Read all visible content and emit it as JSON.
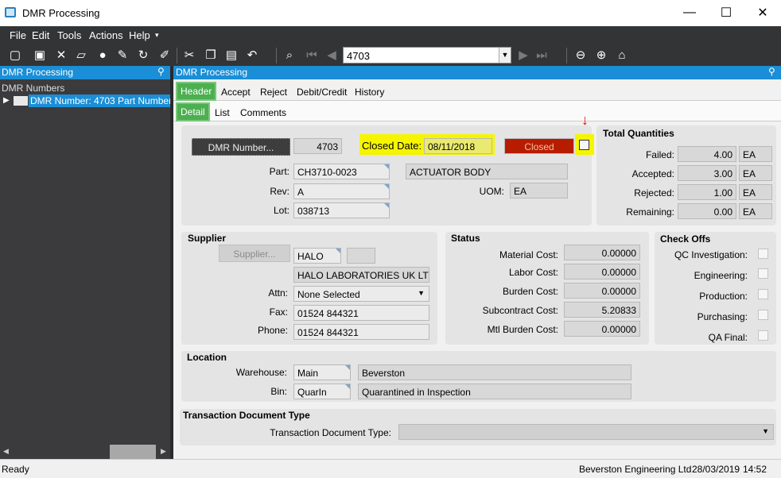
{
  "window": {
    "title": "DMR Processing",
    "min": "—",
    "max": "☐",
    "close": "✕"
  },
  "menu": [
    "File",
    "Edit",
    "Tools",
    "Actions",
    "Help"
  ],
  "toolbar": {
    "combo_value": "4703"
  },
  "left_panel": {
    "header": "DMR Processing",
    "tree_title": "DMR Numbers",
    "tree_item": "DMR Number: 4703 Part Number:"
  },
  "main": {
    "header": "DMR Processing",
    "tabs": [
      "Header",
      "Accept",
      "Reject",
      "Debit/Credit",
      "History"
    ],
    "subtabs": [
      "Detail",
      "List",
      "Comments"
    ]
  },
  "detail": {
    "dmr_button": "DMR Number...",
    "dmr_number": "4703",
    "closed_date_label": "Closed Date:",
    "closed_date": "08/11/2018",
    "closed_status": "Closed",
    "part_label": "Part:",
    "part": "CH3710-0023",
    "part_desc": "ACTUATOR BODY",
    "rev_label": "Rev:",
    "rev": "A",
    "uom_label": "UOM:",
    "uom": "EA",
    "lot_label": "Lot:",
    "lot": "038713"
  },
  "totals": {
    "title": "Total Quantities",
    "rows": [
      {
        "label": "Failed:",
        "value": "4.00",
        "uom": "EA"
      },
      {
        "label": "Accepted:",
        "value": "3.00",
        "uom": "EA"
      },
      {
        "label": "Rejected:",
        "value": "1.00",
        "uom": "EA"
      },
      {
        "label": "Remaining:",
        "value": "0.00",
        "uom": "EA"
      }
    ]
  },
  "supplier": {
    "title": "Supplier",
    "button": "Supplier...",
    "code": "HALO",
    "name": "HALO LABORATORIES UK LT",
    "attn_label": "Attn:",
    "attn": "None Selected",
    "fax_label": "Fax:",
    "fax": "01524 844321",
    "phone_label": "Phone:",
    "phone": "01524 844321"
  },
  "status": {
    "title": "Status",
    "rows": [
      {
        "label": "Material Cost:",
        "value": "0.00000"
      },
      {
        "label": "Labor Cost:",
        "value": "0.00000"
      },
      {
        "label": "Burden Cost:",
        "value": "0.00000"
      },
      {
        "label": "Subcontract Cost:",
        "value": "5.20833"
      },
      {
        "label": "Mtl Burden Cost:",
        "value": "0.00000"
      }
    ]
  },
  "checkoffs": {
    "title": "Check Offs",
    "items": [
      "QC Investigation:",
      "Engineering:",
      "Production:",
      "Purchasing:",
      "QA Final:"
    ]
  },
  "location": {
    "title": "Location",
    "warehouse_label": "Warehouse:",
    "warehouse_code": "Main",
    "warehouse_name": "Beverston",
    "bin_label": "Bin:",
    "bin_code": "QuarIn",
    "bin_name": "Quarantined in Inspection"
  },
  "transaction": {
    "title": "Transaction Document Type",
    "label": "Transaction Document Type:",
    "value": ""
  },
  "statusbar": {
    "left": "Ready",
    "company": "Beverston Engineering Ltd",
    "date": "28/03/2019",
    "time": "14:52"
  },
  "colors": {
    "accent": "#1a8ed6",
    "highlight": "#f5f500",
    "closed": "#b71c00",
    "tab_active": "#4caf50"
  }
}
